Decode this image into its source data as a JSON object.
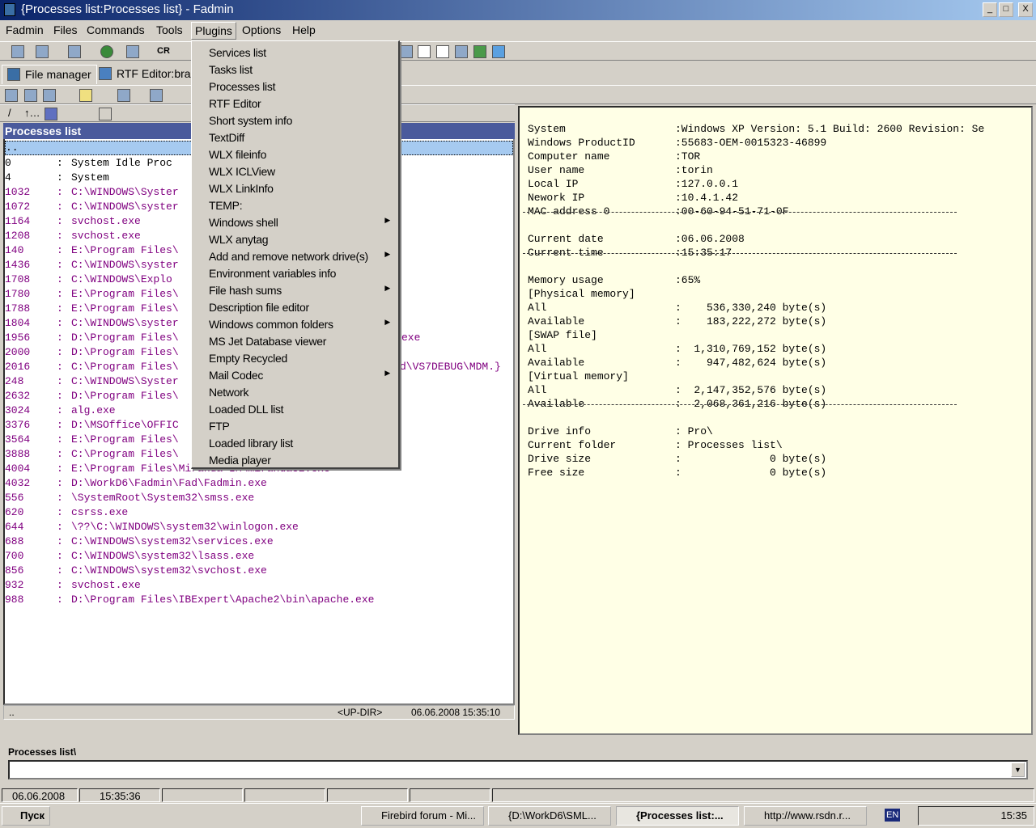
{
  "window": {
    "title": "{Processes list:Processes list} - Fadmin",
    "controls": [
      "_",
      "□",
      "X"
    ]
  },
  "menubar": [
    "Fadmin",
    "Files",
    "Commands",
    "Tools",
    "Plugins",
    "Options",
    "Help"
  ],
  "toolbar": {
    "cr_label": "CR"
  },
  "tabs": [
    {
      "label": "File manager"
    },
    {
      "label": "RTF Editor:brau"
    }
  ],
  "left_panel": {
    "title": "Processes list",
    "updir": "..",
    "rows": [
      {
        "pid": "0",
        "path": "System Idle Proc",
        "sys": true
      },
      {
        "pid": "4",
        "path": "System",
        "sys": true
      },
      {
        "pid": "1032",
        "path": "C:\\WINDOWS\\Syster"
      },
      {
        "pid": "1072",
        "path": "C:\\WINDOWS\\syster"
      },
      {
        "pid": "1164",
        "path": "svchost.exe"
      },
      {
        "pid": "1208",
        "path": "svchost.exe"
      },
      {
        "pid": "140",
        "path": "E:\\Program Files\\"
      },
      {
        "pid": "1436",
        "path": "C:\\WINDOWS\\syster"
      },
      {
        "pid": "1708",
        "path": "C:\\WINDOWS\\Explo"
      },
      {
        "pid": "1780",
        "path": "E:\\Program Files\\"
      },
      {
        "pid": "1788",
        "path": "E:\\Program Files\\"
      },
      {
        "pid": "1804",
        "path": "C:\\WINDOWS\\syster"
      },
      {
        "pid": "1956",
        "path": "D:\\Program Files\\",
        "tail": "exe"
      },
      {
        "pid": "2000",
        "path": "D:\\Program Files\\"
      },
      {
        "pid": "2016",
        "path": "C:\\Program Files\\",
        "tail": "d\\VS7DEBUG\\MDM.}"
      },
      {
        "pid": "248",
        "path": "C:\\WINDOWS\\Syster"
      },
      {
        "pid": "2632",
        "path": "D:\\Program Files\\"
      },
      {
        "pid": "3024",
        "path": "alg.exe"
      },
      {
        "pid": "3376",
        "path": "D:\\MSOffice\\OFFIC"
      },
      {
        "pid": "3564",
        "path": "E:\\Program Files\\"
      },
      {
        "pid": "3888",
        "path": "C:\\Program Files\\"
      },
      {
        "pid": "4004",
        "path": "E:\\Program Files\\Miranda IM\\miranda32.exe"
      },
      {
        "pid": "4032",
        "path": "D:\\WorkD6\\Fadmin\\Fad\\Fadmin.exe"
      },
      {
        "pid": "556",
        "path": "\\SystemRoot\\System32\\smss.exe"
      },
      {
        "pid": "620",
        "path": "csrss.exe"
      },
      {
        "pid": "644",
        "path": "\\??\\C:\\WINDOWS\\system32\\winlogon.exe"
      },
      {
        "pid": "688",
        "path": "C:\\WINDOWS\\system32\\services.exe"
      },
      {
        "pid": "700",
        "path": "C:\\WINDOWS\\system32\\lsass.exe"
      },
      {
        "pid": "856",
        "path": "C:\\WINDOWS\\system32\\svchost.exe"
      },
      {
        "pid": "932",
        "path": "svchost.exe"
      },
      {
        "pid": "988",
        "path": "D:\\Program Files\\IBExpert\\Apache2\\bin\\apache.exe"
      }
    ],
    "status": {
      "name": "..",
      "type": "<UP-DIR>",
      "date": "06.06.2008 15:35:10"
    }
  },
  "right_panel": {
    "groups": [
      [
        {
          "k": "System",
          "v": ":Windows XP Version: 5.1 Build: 2600 Revision: Se"
        },
        {
          "k": "Windows ProductID",
          "v": ":55683-OEM-0015323-46899"
        },
        {
          "k": "Computer name",
          "v": ":TOR"
        },
        {
          "k": "User name",
          "v": ":torin"
        },
        {
          "k": "Local IP",
          "v": ":127.0.0.1"
        },
        {
          "k": "Nework IP",
          "v": ":10.4.1.42"
        },
        {
          "k": "MAC address 0",
          "v": ":00-60-94-51-71-0F"
        }
      ],
      [
        {
          "k": "Current date",
          "v": ":06.06.2008"
        },
        {
          "k": "Current time",
          "v": ":15:35:17"
        }
      ],
      [
        {
          "k": "Memory usage",
          "v": ":65%"
        },
        {
          "k": "[Physical memory]",
          "v": ""
        },
        {
          "k": "All",
          "v": ":    536,330,240 byte(s)"
        },
        {
          "k": "Available",
          "v": ":    183,222,272 byte(s)"
        },
        {
          "k": "[SWAP file]",
          "v": ""
        },
        {
          "k": "All",
          "v": ":  1,310,769,152 byte(s)"
        },
        {
          "k": "Available",
          "v": ":    947,482,624 byte(s)"
        },
        {
          "k": "[Virtual memory]",
          "v": ""
        },
        {
          "k": "All",
          "v": ":  2,147,352,576 byte(s)"
        },
        {
          "k": "Available",
          "v": ":  2,068,361,216 byte(s)"
        }
      ],
      [
        {
          "k": "Drive info",
          "v": ": Pro\\"
        },
        {
          "k": "Current folder",
          "v": ": Processes list\\"
        },
        {
          "k": "Drive size",
          "v": ":              0 byte(s)"
        },
        {
          "k": "Free size",
          "v": ":              0 byte(s)"
        }
      ]
    ]
  },
  "plugins_menu": [
    {
      "label": "Services list"
    },
    {
      "label": "Tasks list"
    },
    {
      "label": "Processes list"
    },
    {
      "label": "RTF Editor"
    },
    {
      "label": "Short system info"
    },
    {
      "label": "TextDiff"
    },
    {
      "label": "WLX fileinfo"
    },
    {
      "label": "WLX ICLView"
    },
    {
      "label": "WLX LinkInfo"
    },
    {
      "label": "TEMP:"
    },
    {
      "label": "Windows shell",
      "sub": true
    },
    {
      "label": "WLX anytag"
    },
    {
      "label": "Add and remove network drive(s)",
      "sub": true
    },
    {
      "label": "Environment variables info"
    },
    {
      "label": "File hash sums",
      "sub": true
    },
    {
      "label": "Description file editor"
    },
    {
      "label": "Windows common folders",
      "sub": true
    },
    {
      "label": "MS Jet Database viewer"
    },
    {
      "label": "Empty Recycled"
    },
    {
      "label": "Mail Codec",
      "sub": true
    },
    {
      "label": "Network"
    },
    {
      "label": "Loaded DLL list"
    },
    {
      "label": "FTP"
    },
    {
      "label": "Loaded library list"
    },
    {
      "label": "Media player"
    }
  ],
  "path_bar": {
    "label": "Processes list\\",
    "value": ""
  },
  "statusbar": {
    "date": "06.06.2008",
    "time": "15:35:36"
  },
  "taskbar": {
    "start": "Пуск",
    "tasks": [
      "Firebird forum - Mi...",
      "{D:\\WorkD6\\SML...",
      "{Processes list:...",
      "http://www.rsdn.r..."
    ],
    "lang": "EN",
    "clock": "15:35"
  }
}
